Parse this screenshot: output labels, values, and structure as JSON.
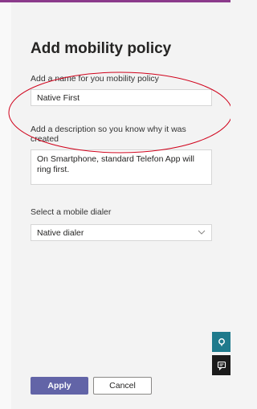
{
  "page": {
    "title": "Add mobility policy",
    "accent_color": "#6264a7",
    "brand_bar_color": "#8b3a8b",
    "annotation_color": "#d0021b"
  },
  "form": {
    "name_label": "Add a name for you mobility policy",
    "name_value": "Native First",
    "description_label": "Add a description so you know why it was created",
    "description_value": "On Smartphone, standard Telefon App will ring first.",
    "dialer_label": "Select a mobile dialer",
    "dialer_value": "Native dialer"
  },
  "actions": {
    "apply_label": "Apply",
    "cancel_label": "Cancel"
  },
  "side_buttons": {
    "help_icon": "help-icon",
    "feedback_icon": "feedback-icon"
  }
}
